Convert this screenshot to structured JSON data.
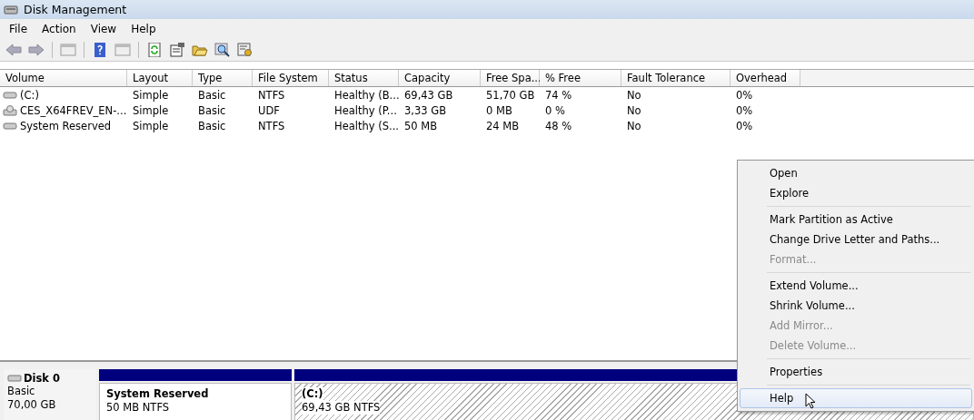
{
  "window": {
    "title": "Disk Management"
  },
  "menu_bar": [
    "File",
    "Action",
    "View",
    "Help"
  ],
  "table": {
    "columns": [
      "Volume",
      "Layout",
      "Type",
      "File System",
      "Status",
      "Capacity",
      "Free Spa...",
      "% Free",
      "Fault Tolerance",
      "Overhead"
    ],
    "rows": [
      {
        "kind": "hdd",
        "cells": [
          "(C:)",
          "Simple",
          "Basic",
          "NTFS",
          "Healthy (B...",
          "69,43 GB",
          "51,70 GB",
          "74 %",
          "No",
          "0%"
        ]
      },
      {
        "kind": "cd",
        "cells": [
          "CES_X64FREV_EN-...",
          "Simple",
          "Basic",
          "UDF",
          "Healthy (P...",
          "3,33 GB",
          "0 MB",
          "0 %",
          "No",
          "0%"
        ]
      },
      {
        "kind": "hdd",
        "cells": [
          "System Reserved",
          "Simple",
          "Basic",
          "NTFS",
          "Healthy (S...",
          "50 MB",
          "24 MB",
          "48 %",
          "No",
          "0%"
        ]
      }
    ]
  },
  "disk": {
    "name": "Disk 0",
    "type": "Basic",
    "size": "70,00 GB"
  },
  "partitions": [
    {
      "name": "System Reserved",
      "size": "50 MB NTFS",
      "selected": false
    },
    {
      "name": "(C:)",
      "size": "69,43 GB NTFS",
      "selected": true
    }
  ],
  "context_menu": [
    {
      "kind": "item",
      "label": "Open",
      "disabled": false,
      "selected": false
    },
    {
      "kind": "item",
      "label": "Explore",
      "disabled": false,
      "selected": false
    },
    {
      "kind": "separator"
    },
    {
      "kind": "item",
      "label": "Mark Partition as Active",
      "disabled": false,
      "selected": false
    },
    {
      "kind": "item",
      "label": "Change Drive Letter and Paths...",
      "disabled": false,
      "selected": false
    },
    {
      "kind": "item",
      "label": "Format...",
      "disabled": true,
      "selected": false
    },
    {
      "kind": "separator"
    },
    {
      "kind": "item",
      "label": "Extend Volume...",
      "disabled": false,
      "selected": false
    },
    {
      "kind": "item",
      "label": "Shrink Volume...",
      "disabled": false,
      "selected": false
    },
    {
      "kind": "item",
      "label": "Add Mirror...",
      "disabled": true,
      "selected": false
    },
    {
      "kind": "item",
      "label": "Delete Volume...",
      "disabled": true,
      "selected": false
    },
    {
      "kind": "separator"
    },
    {
      "kind": "item",
      "label": "Properties",
      "disabled": false,
      "selected": false
    },
    {
      "kind": "separator"
    },
    {
      "kind": "item",
      "label": "Help",
      "disabled": false,
      "selected": true
    }
  ]
}
